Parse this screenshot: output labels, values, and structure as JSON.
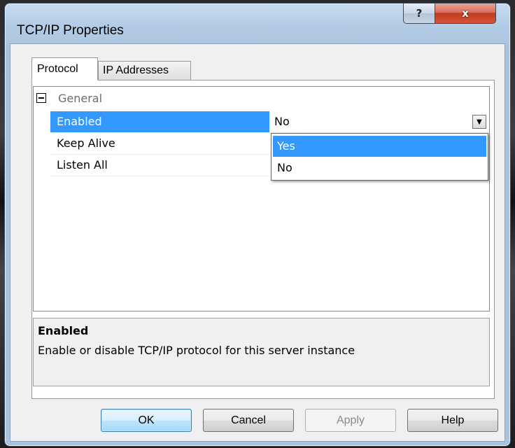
{
  "window": {
    "title": "TCP/IP Properties",
    "help_glyph": "?",
    "close_glyph": "x"
  },
  "tabs": [
    {
      "label": "Protocol",
      "selected": true
    },
    {
      "label": "IP Addresses",
      "selected": false
    }
  ],
  "property_grid": {
    "category": "General",
    "rows": [
      {
        "name": "Enabled",
        "value": "No",
        "selected": true
      },
      {
        "name": "Keep Alive",
        "value": ""
      },
      {
        "name": "Listen All",
        "value": ""
      }
    ],
    "dropdown_glyph": "▼",
    "dropdown_options": [
      "Yes",
      "No"
    ],
    "highlighted_option": "Yes"
  },
  "description": {
    "title": "Enabled",
    "text": "Enable or disable TCP/IP protocol for this server instance"
  },
  "buttons": {
    "ok": "OK",
    "cancel": "Cancel",
    "apply": "Apply",
    "help": "Help"
  },
  "colors": {
    "selection": "#3399ff",
    "window_frame": "#b4cde6",
    "close_button": "#c33a1f"
  }
}
